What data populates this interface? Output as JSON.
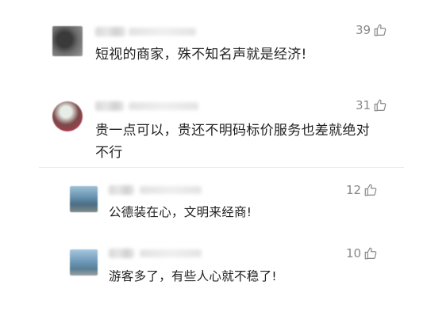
{
  "comments": [
    {
      "likes": "39",
      "text": "短视的商家，殊不知名声就是经济!"
    },
    {
      "likes": "31",
      "text_line1": "贵一点可以，贵还不明码标价服务也差就绝对",
      "text_line2": "不行"
    }
  ],
  "replies": [
    {
      "likes": "12",
      "text": "公德装在心，文明来经商!"
    },
    {
      "likes": "10",
      "text": "游客多了，有些人心就不稳了!"
    }
  ],
  "icons": {
    "like": "thumbs-up-icon"
  }
}
